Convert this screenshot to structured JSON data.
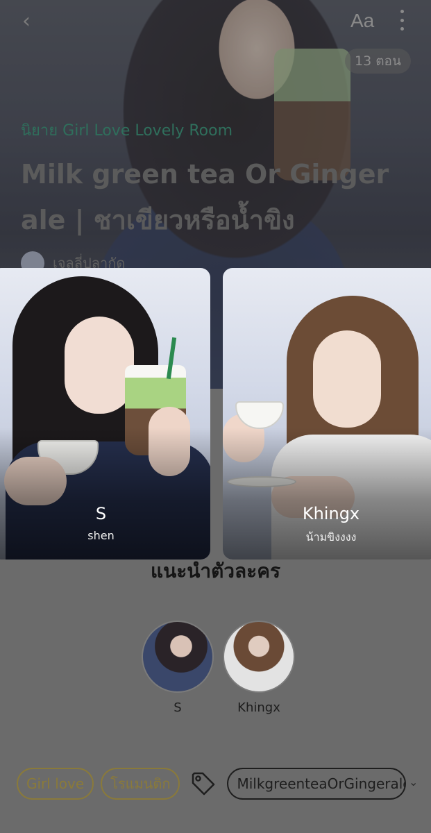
{
  "header": {
    "font_size_label": "Aa",
    "episode_badge": "13 ตอน"
  },
  "story": {
    "category": "นิยาย Girl Love Lovely Room",
    "title_line1": "Milk green tea Or Ginger",
    "title_line2": "ale | ชาเขียวหรือน้ำขิง",
    "author": "เจลลี่ปลากัด"
  },
  "characters_section": {
    "title": "แนะนำตัวละคร",
    "items": [
      {
        "name": "S",
        "subtitle": "shen"
      },
      {
        "name": "Khingx",
        "subtitle": "น้ามขิงงงง"
      }
    ]
  },
  "tags": {
    "items": [
      "Girl love",
      "โรแมนติก"
    ],
    "hashtag": "MilkgreenteaOrGingerale"
  },
  "colors": {
    "category_green": "#2f6f5c",
    "tag_gold": "#8a7a3a",
    "overlay_gray": "#6b6b6b"
  },
  "icons": [
    "back-arrow-icon",
    "font-size-icon",
    "more-vertical-icon",
    "tag-icon",
    "chevron-down-icon"
  ]
}
